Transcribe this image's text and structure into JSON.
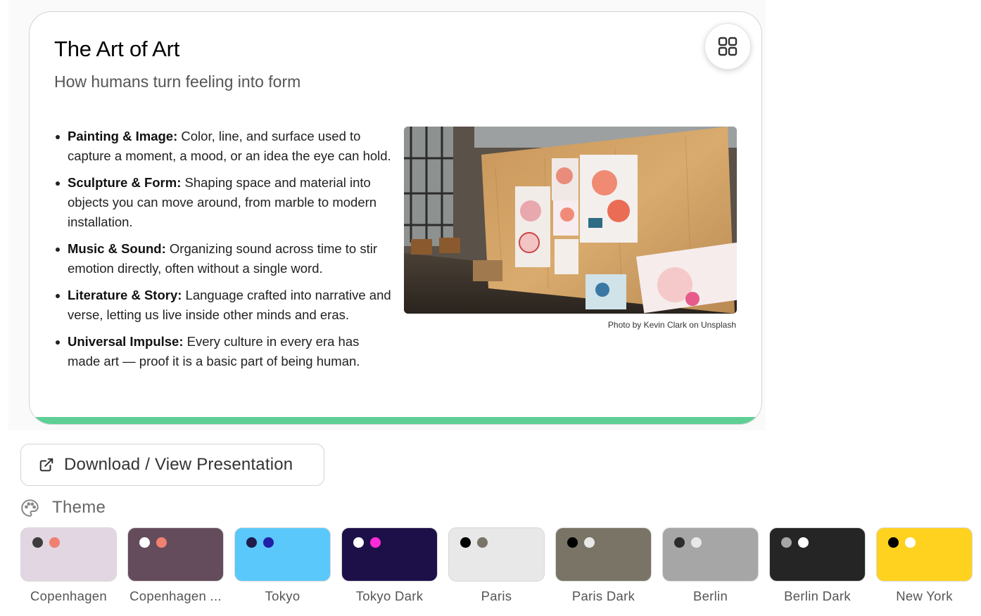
{
  "slide": {
    "title": "The Art of Art",
    "subtitle": "How humans turn feeling into form",
    "bullets": [
      {
        "term": "Painting & Image:",
        "text": " Color, line, and surface used to capture a moment, a mood, or an idea the eye can hold."
      },
      {
        "term": "Sculpture & Form:",
        "text": " Shaping space and material into objects you can move around, from marble to modern installation."
      },
      {
        "term": "Music & Sound:",
        "text": " Organizing sound across time to stir emotion directly, often without a single word."
      },
      {
        "term": "Literature & Story:",
        "text": " Language crafted into narrative and verse, letting us live inside other minds and eras."
      },
      {
        "term": "Universal Impulse:",
        "text": " Every culture in every era has made art — proof it is a basic part of being human."
      }
    ],
    "photo_caption": "Photo by Kevin Clark on Unsplash",
    "accent_color": "#5fcf95",
    "grid_icon": "grid-icon"
  },
  "download": {
    "label": "Download / View Presentation",
    "icon": "external-link-icon"
  },
  "theme_section": {
    "label": "Theme",
    "icon": "palette-icon",
    "themes": [
      {
        "name": "Copenhagen",
        "bg": "#e2d6e2",
        "dot1": "#3d3d3d",
        "dot2": "#f08070"
      },
      {
        "name": "Copenhagen ...",
        "bg": "#644c5c",
        "dot1": "#ffffff",
        "dot2": "#f08070"
      },
      {
        "name": "Tokyo",
        "bg": "#5ac8fa",
        "dot1": "#1f1b4d",
        "dot2": "#2020a8"
      },
      {
        "name": "Tokyo Dark",
        "bg": "#1d1048",
        "dot1": "#ffffff",
        "dot2": "#ff2ad8"
      },
      {
        "name": "Paris",
        "bg": "#e8e8e8",
        "dot1": "#000000",
        "dot2": "#7a7466"
      },
      {
        "name": "Paris Dark",
        "bg": "#7a7466",
        "dot1": "#000000",
        "dot2": "#e8e8e8"
      },
      {
        "name": "Berlin",
        "bg": "#a6a6a6",
        "dot1": "#2c2c2c",
        "dot2": "#e8e8e8"
      },
      {
        "name": "Berlin Dark",
        "bg": "#252525",
        "dot1": "#a6a6a6",
        "dot2": "#ffffff"
      },
      {
        "name": "New York",
        "bg": "#ffd21f",
        "dot1": "#000000",
        "dot2": "#ffffff"
      }
    ]
  }
}
